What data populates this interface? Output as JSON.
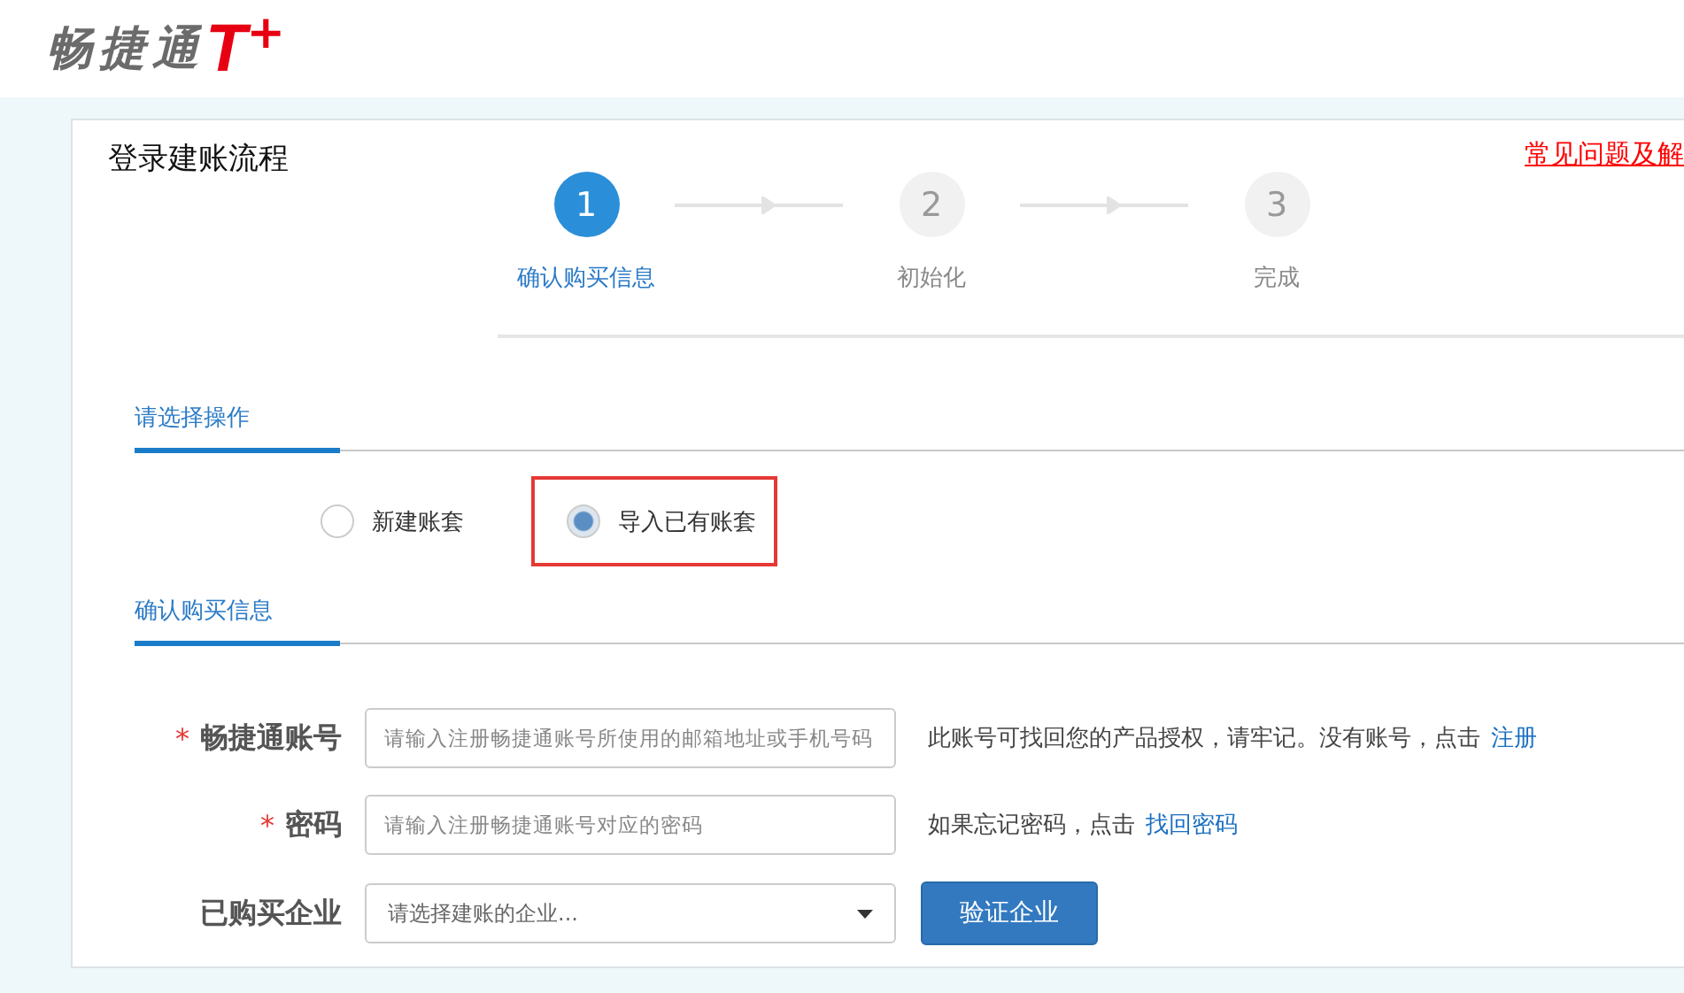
{
  "logo": {
    "brand": "畅捷通",
    "mark": "T",
    "plus": "+"
  },
  "panel": {
    "title": "登录建账流程",
    "help_link": "常见问题及解"
  },
  "steps": [
    {
      "number": "1",
      "label": "确认购买信息",
      "selected": true
    },
    {
      "number": "2",
      "label": "初始化",
      "selected": false
    },
    {
      "number": "3",
      "label": "完成",
      "selected": false
    }
  ],
  "operation": {
    "heading": "请选择操作",
    "options": [
      {
        "label": "新建账套",
        "selected": false,
        "highlighted": false
      },
      {
        "label": "导入已有账套",
        "selected": true,
        "highlighted": true
      }
    ]
  },
  "purchase": {
    "heading": "确认购买信息",
    "fields": [
      {
        "kind": "text",
        "required_mark": "*",
        "label": "畅捷通账号",
        "placeholder": "请输入注册畅捷通账号所使用的邮箱地址或手机号码",
        "hint": "此账号可找回您的产品授权，请牢记。没有账号，点击",
        "link": "注册"
      },
      {
        "kind": "text",
        "required_mark": "*",
        "label": "密码",
        "placeholder": "请输入注册畅捷通账号对应的密码",
        "hint": "如果忘记密码，点击",
        "link": "找回密码"
      },
      {
        "kind": "select",
        "label": "已购买企业",
        "placeholder": "请选择建账的企业...",
        "button": "验证企业"
      }
    ]
  }
}
